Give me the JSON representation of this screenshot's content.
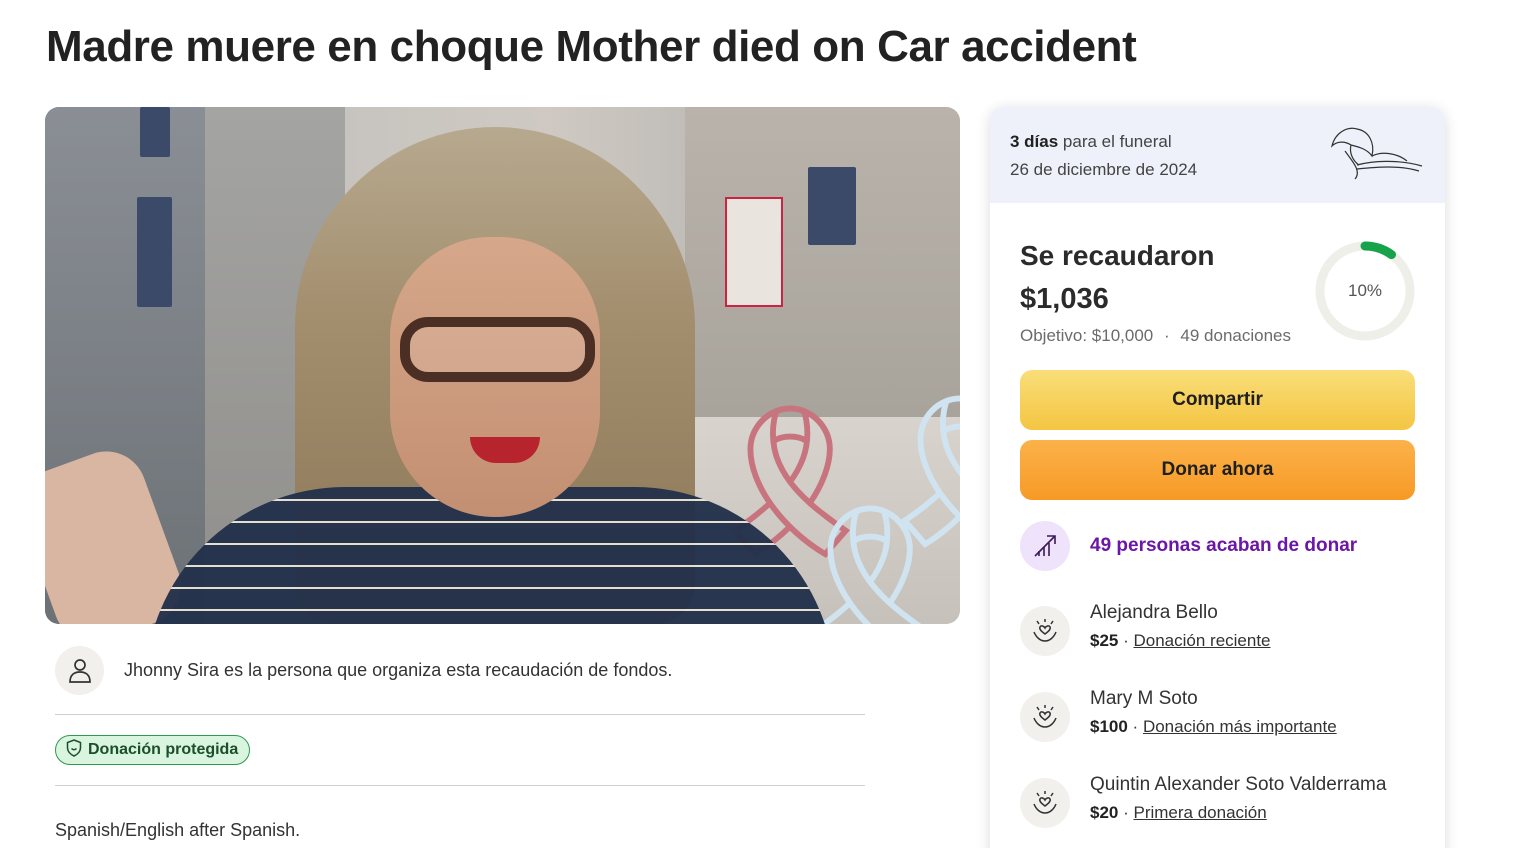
{
  "page": {
    "title": "Madre muere en choque Mother died on Car accident"
  },
  "organizer": {
    "text": "Jhonny Sira es la persona que organiza esta recaudación de fondos.",
    "icon": "person-icon"
  },
  "badge": {
    "label": "Donación protegida",
    "icon": "shield-icon",
    "color": "#2e9a4d"
  },
  "description": {
    "text": "Spanish/English after Spanish."
  },
  "funeral": {
    "days_bold": "3 días",
    "days_rest": " para el funeral",
    "date": "26 de diciembre de 2024",
    "icon": "lily-flower-icon"
  },
  "progress": {
    "label": "Se recaudaron",
    "amount": "$1,036",
    "goal": "Objetivo: $10,000",
    "separator": "·",
    "donations": "49 donaciones",
    "percent_label": "10%",
    "percent": 10,
    "ring_color": "#16a34a"
  },
  "buttons": {
    "share": "Compartir",
    "donate": "Donar ahora"
  },
  "trend": {
    "text": "49 personas acaban de donar",
    "icon": "trending-up-icon",
    "color": "#6b16a8"
  },
  "donors": [
    {
      "name": "Alejandra Bello",
      "amount": "$25",
      "sep": " · ",
      "tag": "Donación reciente",
      "icon": "heart-hands-icon"
    },
    {
      "name": "Mary M Soto",
      "amount": "$100",
      "sep": " · ",
      "tag": "Donación más importante",
      "icon": "heart-hands-icon"
    },
    {
      "name": "Quintin Alexander Soto Valderrama",
      "amount": "$20",
      "sep": " · ",
      "tag": "Primera donación",
      "icon": "heart-hands-icon"
    }
  ]
}
